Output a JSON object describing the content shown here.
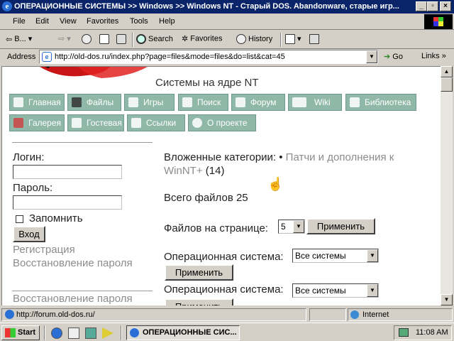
{
  "window": {
    "title": "ОПЕРАЦИОННЫЕ СИСТЕМЫ >> Windows >> Windows NT - Старый DOS. Abandonware, старые игр...",
    "minimize": "_",
    "maximize": "▫",
    "close": "×"
  },
  "menu": {
    "file": "File",
    "edit": "Edit",
    "view": "View",
    "favorites": "Favorites",
    "tools": "Tools",
    "help": "Help"
  },
  "toolbar": {
    "back": "B...",
    "search": "Search",
    "favorites": "Favorites",
    "history": "History"
  },
  "address": {
    "label": "Address",
    "url": "http://old-dos.ru/index.php?page=files&mode=files&do=list&cat=45",
    "go": "Go",
    "links": "Links"
  },
  "page": {
    "heading": "Системы на ядре NT",
    "nav": [
      "Главная",
      "Файлы",
      "Игры",
      "Поиск",
      "Форум",
      "Wiki",
      "Библиотека",
      "Галерея",
      "Гостевая",
      "Ссылки",
      "О проекте"
    ],
    "login": {
      "login_label": "Логин:",
      "password_label": "Пароль:",
      "remember_label": "Запомнить",
      "submit": "Вход",
      "register": "Регистрация",
      "restore": "Восстановление пароля",
      "restore_dup": "Восстановление пароля"
    },
    "main": {
      "subcats_label": "Вложенные категории:",
      "subcat_bullet": "•",
      "subcat_link_1": "Патчи и дополнения к",
      "subcat_link_2": "WinNT+",
      "subcat_count": "(14)",
      "total_files": "Всего файлов 25",
      "per_page_label": "Файлов на странице:",
      "per_page_value": "5",
      "apply": "Применить",
      "os_label": "Операционная система:",
      "os_value": "Все системы",
      "os_apply": "Применить",
      "os_label_dup": "Операционная система:",
      "os_value_dup": "Все системы",
      "os_apply_dup": "Применить"
    }
  },
  "status": {
    "text": "http://forum.old-dos.ru/",
    "zone": "Internet"
  },
  "taskbar": {
    "start": "Start",
    "task": "ОПЕРАЦИОННЫЕ СИС...",
    "clock": "11:08 AM"
  }
}
